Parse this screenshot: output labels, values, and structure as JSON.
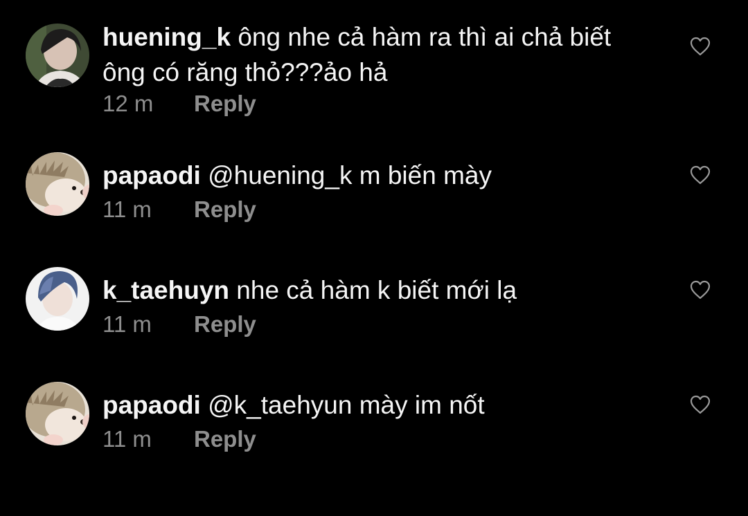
{
  "comments": [
    {
      "username": "huening_k",
      "text": "ông nhe cả hàm ra thì ai chả biết ông có răng thỏ???ảo hả",
      "time": "12 m",
      "reply_label": "Reply",
      "avatar": "person-avatar-dark-hair",
      "like_icon": "heart-outline-icon"
    },
    {
      "username": "papaodi",
      "text": "@huening_k m biến mày",
      "time": "11 m",
      "reply_label": "Reply",
      "avatar": "hedgehog-avatar",
      "like_icon": "heart-outline-icon"
    },
    {
      "username": "k_taehuyn",
      "text": "nhe cả hàm k biết mới lạ",
      "time": "11 m",
      "reply_label": "Reply",
      "avatar": "person-avatar-blue-hair",
      "like_icon": "heart-outline-icon"
    },
    {
      "username": "papaodi",
      "text": "@k_taehyun mày im nốt",
      "time": "11 m",
      "reply_label": "Reply",
      "avatar": "hedgehog-avatar",
      "like_icon": "heart-outline-icon"
    }
  ],
  "colors": {
    "background": "#000000",
    "text": "#f5f5f5",
    "secondary_text": "#8e8e8e"
  }
}
